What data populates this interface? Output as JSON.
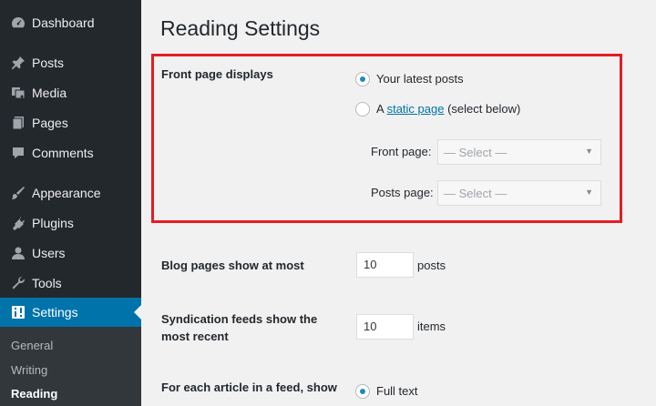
{
  "sidebar": {
    "items": [
      {
        "label": "Dashboard",
        "icon": "dashboard-icon"
      },
      {
        "label": "Posts",
        "icon": "pin-icon"
      },
      {
        "label": "Media",
        "icon": "media-icon"
      },
      {
        "label": "Pages",
        "icon": "pages-icon"
      },
      {
        "label": "Comments",
        "icon": "comment-icon"
      },
      {
        "label": "Appearance",
        "icon": "brush-icon"
      },
      {
        "label": "Plugins",
        "icon": "plug-icon"
      },
      {
        "label": "Users",
        "icon": "user-icon"
      },
      {
        "label": "Tools",
        "icon": "wrench-icon"
      },
      {
        "label": "Settings",
        "icon": "settings-icon"
      }
    ],
    "active": "Settings",
    "submenu": [
      "General",
      "Writing",
      "Reading"
    ],
    "current_submenu": "Reading"
  },
  "main": {
    "title": "Reading Settings",
    "front_page": {
      "label": "Front page displays",
      "option_latest": "Your latest posts",
      "option_static_prefix": "A",
      "option_static_link": "static page",
      "option_static_suffix": "(select below)",
      "selected": "Your latest posts",
      "front_page_label": "Front page:",
      "front_page_value": "— Select —",
      "posts_page_label": "Posts page:",
      "posts_page_value": "— Select —"
    },
    "blog_pages": {
      "label": "Blog pages show at most",
      "value": "10",
      "suffix": "posts"
    },
    "syndication": {
      "label_line1": "Syndication feeds show the",
      "label_line2": "most recent",
      "value": "10",
      "suffix": "items"
    },
    "feed_article": {
      "label": "For each article in a feed, show",
      "option_full": "Full text"
    }
  },
  "colors": {
    "sidebar_bg": "#23282d",
    "active": "#0073aa",
    "highlight": "#e51c23",
    "link": "#0073aa"
  }
}
